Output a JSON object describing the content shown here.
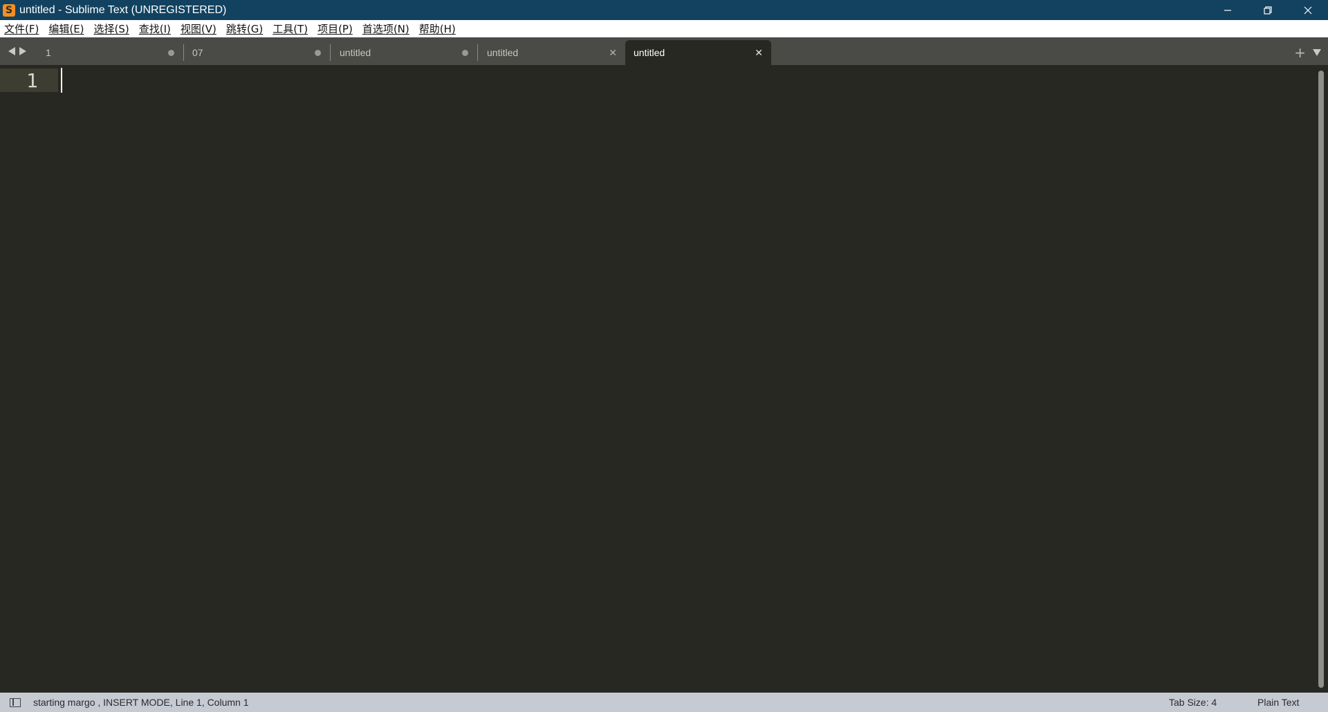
{
  "window": {
    "title": "untitled - Sublime Text (UNREGISTERED)",
    "app_icon_letter": "S"
  },
  "menu": {
    "items": [
      "文件(F)",
      "编辑(E)",
      "选择(S)",
      "查找(I)",
      "视图(V)",
      "跳转(G)",
      "工具(T)",
      "项目(P)",
      "首选项(N)",
      "帮助(H)"
    ]
  },
  "tabs": [
    {
      "label": "1",
      "state": "dirty"
    },
    {
      "label": "07",
      "state": "dirty"
    },
    {
      "label": "untitled",
      "state": "dirty"
    },
    {
      "label": "untitled",
      "state": "close"
    },
    {
      "label": "untitled",
      "state": "active"
    }
  ],
  "tabbar": {
    "new_tab": "+"
  },
  "editor": {
    "line_numbers": [
      "1"
    ]
  },
  "status": {
    "message": "starting margo , INSERT MODE, Line 1, Column 1",
    "tab_size": "Tab Size: 4",
    "syntax": "Plain Text"
  },
  "colors": {
    "titlebar": "#124260",
    "editor_bg": "#272822",
    "tabbar_bg": "#4a4a46",
    "statusbar_bg": "#c5cad3",
    "app_icon": "#f48f1f"
  }
}
